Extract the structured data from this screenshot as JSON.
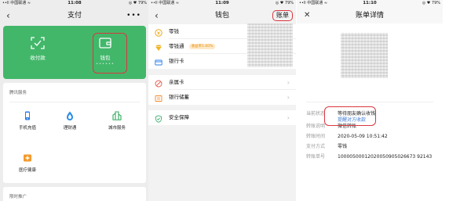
{
  "status_bar": {
    "p1": {
      "carrier": "••ll 中国联通 ≈",
      "time": "11:08",
      "battery": "◎ ♥ 79%"
    },
    "p2": {
      "carrier": "••ll 中国联通 ≈",
      "time": "11:09",
      "battery": "◎ ♥ 79%"
    },
    "p3": {
      "carrier": "••ll 中国联通 ≈",
      "time": "11:10",
      "battery": "◎ ♥ 79%"
    }
  },
  "screen_pay": {
    "back": "‹",
    "title": "支付",
    "more": "•••",
    "quick": {
      "scan_label": "收付款",
      "wallet_label": "钱包",
      "wallet_dots": "••••••"
    },
    "services": {
      "section_title": "腾讯服务",
      "items": [
        {
          "label": "手机充值"
        },
        {
          "label": "理财通"
        },
        {
          "label": "城市服务"
        },
        {
          "label": "医疗健康"
        }
      ]
    },
    "promo_title": "限时推广"
  },
  "screen_wallet": {
    "back": "‹",
    "title": "钱包",
    "bill_button": "账单",
    "rows": [
      {
        "label": "零钱"
      },
      {
        "label": "零钱通",
        "badge": "收益率1.60%"
      },
      {
        "label": "银行卡",
        "chevron": "›"
      },
      {
        "label": "亲属卡",
        "chevron": "›"
      },
      {
        "label": "银行储蓄",
        "chevron": "›"
      },
      {
        "label": "安全保障",
        "chevron": "›"
      }
    ]
  },
  "screen_detail": {
    "close": "✕",
    "title": "账单详情",
    "fields": {
      "status_key": "当前状态",
      "status_value": "等待朋友确认收钱",
      "remind_link": "提醒对方收款",
      "desc_key": "转账说明",
      "desc_value": "微信转账",
      "time_key": "转账时间",
      "time_value": "2020-05-09 10:51:42",
      "pay_key": "支付方式",
      "pay_value": "零钱",
      "no_key": "转账单号",
      "no_value": "10000500012020050905026673 92143"
    }
  },
  "colors": {
    "wechat_green": "#42b76a",
    "highlight_red": "#d9373f",
    "link_blue": "#3e7bd6",
    "badge_orange": "#e8900f"
  }
}
